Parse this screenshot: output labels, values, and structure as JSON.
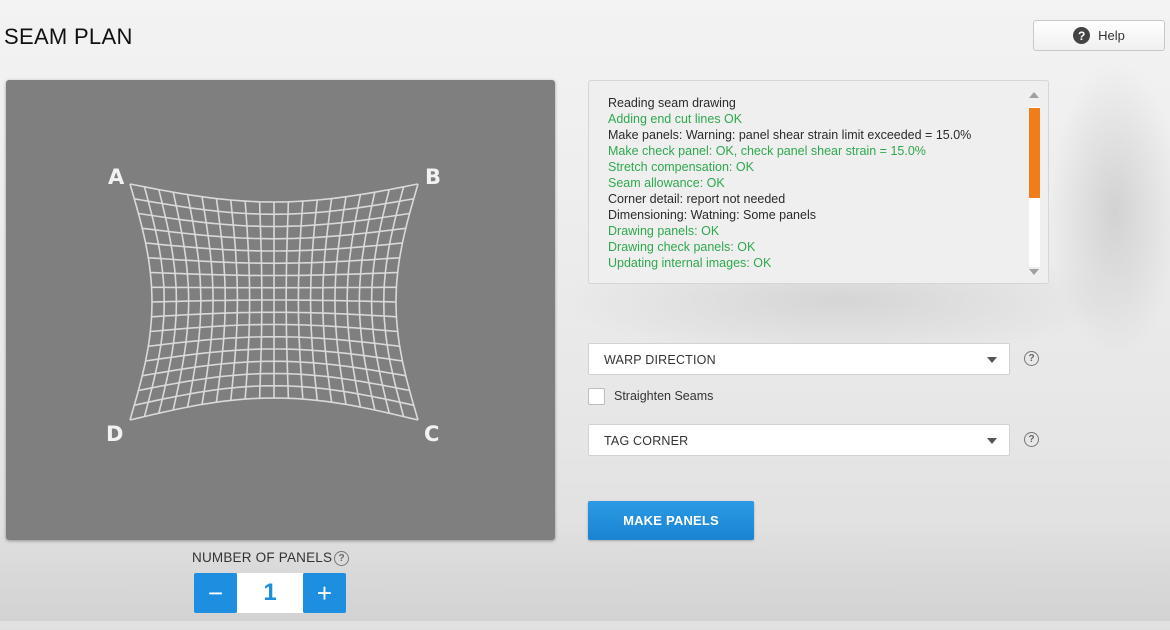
{
  "header": {
    "title": "SEAM PLAN",
    "help_label": "Help",
    "help_icon": "question-circle-icon"
  },
  "canvas": {
    "corners": {
      "a": "A",
      "b": "B",
      "c": "C",
      "d": "D"
    },
    "grid_color": "#d9d9d9",
    "background_color": "#7f7f7f"
  },
  "log": {
    "lines": [
      {
        "text": "Reading seam drawing",
        "status": "plain"
      },
      {
        "text": "Adding end cut lines OK",
        "status": "ok"
      },
      {
        "text": "Make panels: Warning: panel shear strain limit exceeded = 15.0%",
        "status": "plain"
      },
      {
        "text": "Make check panel: OK, check panel shear strain = 15.0%",
        "status": "ok"
      },
      {
        "text": "Stretch compensation: OK",
        "status": "ok"
      },
      {
        "text": "Seam allowance: OK",
        "status": "ok"
      },
      {
        "text": "Corner detail: report not needed",
        "status": "plain"
      },
      {
        "text": "Dimensioning: Watning: Some panels",
        "status": "plain"
      },
      {
        "text": "Drawing panels: OK",
        "status": "ok"
      },
      {
        "text": "Drawing check panels: OK",
        "status": "ok"
      },
      {
        "text": "Updating internal images: OK",
        "status": "ok"
      }
    ],
    "ok_color": "#2fa84f",
    "scroll_thumb_color": "#f07d18"
  },
  "controls": {
    "warp_direction": "WARP DIRECTION",
    "straighten_seams_label": "Straighten Seams",
    "straighten_seams_checked": false,
    "tag_corner": "TAG CORNER",
    "make_panels_label": "MAKE PANELS",
    "accent_color": "#1e8ee0"
  },
  "panels": {
    "label": "NUMBER OF PANELS",
    "value": "1",
    "minus_symbol": "−",
    "plus_symbol": "+"
  }
}
